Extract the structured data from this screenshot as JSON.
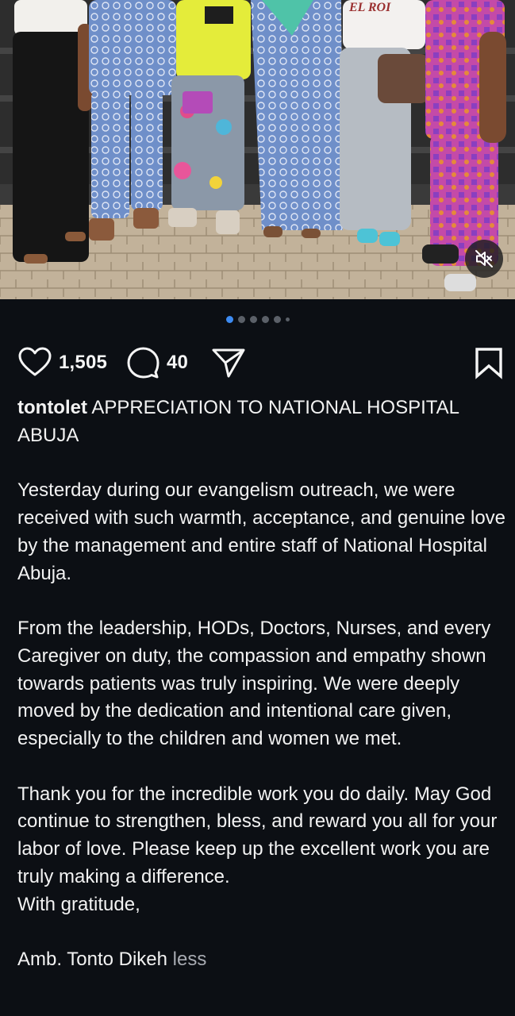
{
  "post": {
    "image_alt": "Group of people standing on steps",
    "carousel": {
      "total_dots": 6,
      "active_index": 0
    },
    "likes": "1,505",
    "comments": "40",
    "icons": {
      "like": "heart-icon",
      "comment": "comment-bubble-icon",
      "share": "send-icon",
      "save": "bookmark-icon",
      "mute": "speaker-muted-icon"
    }
  },
  "caption": {
    "username": "tontolet",
    "title": "APPRECIATION TO NATIONAL HOSPITAL ABUJA",
    "paragraph1": "Yesterday during our evangelism outreach, we were received with such warmth, acceptance, and genuine love by the management and entire staff of National Hospital Abuja.",
    "paragraph2": "From the leadership, HODs, Doctors, Nurses, and every Caregiver on duty, the compassion and empathy shown towards patients was truly inspiring. We were deeply moved by the dedication and intentional care given, especially to the children and women we met.",
    "paragraph3": "Thank you for the incredible work you do daily. May God continue to strengthen, bless, and reward you all for your labor of love. Please keep up the excellent work  you are truly making a difference.",
    "closing": "With gratitude,",
    "signature": "Amb. Tonto Dikeh",
    "less_label": "less"
  },
  "colors": {
    "background": "#0c0f14",
    "text": "#f5f5f5",
    "muted": "#a8abb2",
    "accent_dot": "#3d8bf2"
  }
}
